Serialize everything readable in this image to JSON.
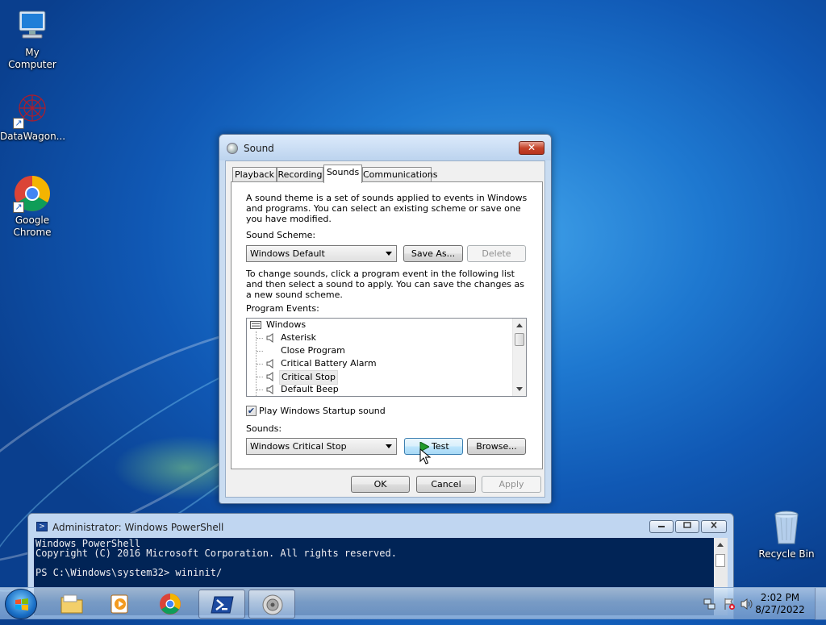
{
  "desktop": {
    "icons": [
      {
        "label": "My Computer"
      },
      {
        "label": "DataWagon..."
      },
      {
        "label": "Google Chrome"
      },
      {
        "label": "Recycle Bin"
      }
    ]
  },
  "sound_dialog": {
    "title": "Sound",
    "close_label": "✕",
    "tabs": [
      {
        "label": "Playback"
      },
      {
        "label": "Recording"
      },
      {
        "label": "Sounds",
        "active": true
      },
      {
        "label": "Communications"
      }
    ],
    "intro_text": "A sound theme is a set of sounds applied to events in Windows and programs.  You can select an existing scheme or save one you have modified.",
    "scheme_label": "Sound Scheme:",
    "scheme_value": "Windows Default",
    "save_as_label": "Save As...",
    "delete_label": "Delete",
    "change_text": "To change sounds, click a program event in the following list and then select a sound to apply.  You can save the changes as a new sound scheme.",
    "events_label": "Program Events:",
    "events": {
      "group": "Windows",
      "items": [
        {
          "label": "Asterisk",
          "has_sound": true
        },
        {
          "label": "Close Program",
          "has_sound": false
        },
        {
          "label": "Critical Battery Alarm",
          "has_sound": true
        },
        {
          "label": "Critical Stop",
          "has_sound": true,
          "selected": true
        },
        {
          "label": "Default Beep",
          "has_sound": true
        }
      ]
    },
    "startup_label": "Play Windows Startup sound",
    "startup_checked": true,
    "check_mark": "✔",
    "sounds_label": "Sounds:",
    "sound_value": "Windows Critical Stop",
    "test_label": "Test",
    "browse_label": "Browse...",
    "ok_label": "OK",
    "cancel_label": "Cancel",
    "apply_label": "Apply"
  },
  "powershell": {
    "title": "Administrator: Windows PowerShell",
    "lines": [
      "Windows PowerShell",
      "Copyright (C) 2016 Microsoft Corporation. All rights reserved.",
      "",
      "PS C:\\Windows\\system32> wininit/"
    ]
  },
  "taskbar": {
    "time": "2:02 PM",
    "date": "8/27/2022"
  },
  "colors": {
    "console_bg": "#012456",
    "accent": "#1e78d0"
  }
}
